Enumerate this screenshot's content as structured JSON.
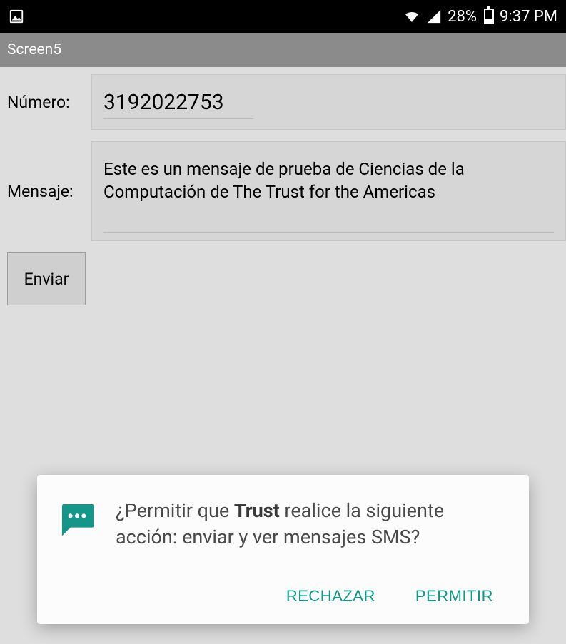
{
  "status_bar": {
    "battery_percent": "28%",
    "time": "9:37 PM"
  },
  "title_bar": {
    "title": "Screen5"
  },
  "form": {
    "number_label": "Número:",
    "number_value": "3192022753",
    "message_label": "Mensaje:",
    "message_value": "Este es un mensaje de prueba de Ciencias de la Computación de The Trust for the Americas",
    "send_label": "Enviar"
  },
  "dialog": {
    "text_prefix": "¿Permitir que ",
    "app_name": "Trust",
    "text_suffix": " realice la siguiente acción: enviar y ver mensajes SMS?",
    "reject_label": "RECHAZAR",
    "allow_label": "PERMITIR"
  },
  "colors": {
    "accent": "#159688"
  }
}
